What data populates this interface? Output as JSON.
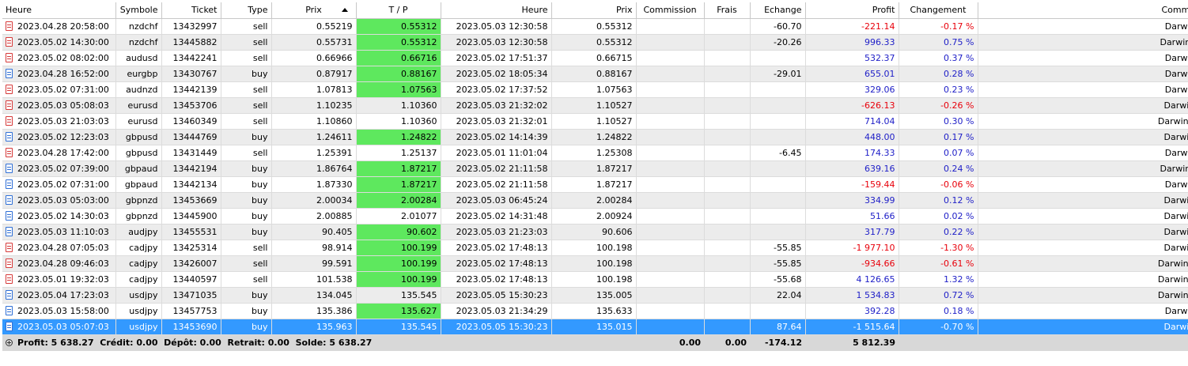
{
  "columns": {
    "open_time": "Heure",
    "symbol": "Symbole",
    "ticket": "Ticket",
    "type": "Type",
    "open_price": "Prix",
    "tp": "T / P",
    "close_time": "Heure",
    "close_price": "Prix",
    "commission": "Commission",
    "fees": "Frais",
    "swap": "Echange",
    "profit": "Profit",
    "change": "Changement",
    "comment": "Commentair"
  },
  "rows": [
    {
      "open_time": "2023.04.28 20:58:00",
      "symbol": "nzdchf",
      "ticket": "13432997",
      "type": "sell",
      "open_price": "0.55219",
      "tp": "0.55312",
      "tp_hit": true,
      "close_time": "2023.05.03 12:30:58",
      "close_price": "0.55312",
      "commission": "",
      "fees": "",
      "swap": "-60.70",
      "profit": "-221.14",
      "change": "-0.17 %",
      "comment": "Darwin Swing E"
    },
    {
      "open_time": "2023.05.02 14:30:00",
      "symbol": "nzdchf",
      "ticket": "13445882",
      "type": "sell",
      "open_price": "0.55731",
      "tp": "0.55312",
      "tp_hit": true,
      "close_time": "2023.05.03 12:30:58",
      "close_price": "0.55312",
      "commission": "",
      "fees": "",
      "swap": "-20.26",
      "profit": "996.33",
      "change": "0.75 %",
      "comment": "Darwin Swing EF"
    },
    {
      "open_time": "2023.05.02 08:02:00",
      "symbol": "audusd",
      "ticket": "13442241",
      "type": "sell",
      "open_price": "0.66966",
      "tp": "0.66716",
      "tp_hit": true,
      "close_time": "2023.05.02 17:51:37",
      "close_price": "0.66715",
      "commission": "",
      "fees": "",
      "swap": "",
      "profit": "532.37",
      "change": "0.37 %",
      "comment": "Darwin Swing E"
    },
    {
      "open_time": "2023.04.28 16:52:00",
      "symbol": "eurgbp",
      "ticket": "13430767",
      "type": "buy",
      "open_price": "0.87917",
      "tp": "0.88167",
      "tp_hit": true,
      "close_time": "2023.05.02 18:05:34",
      "close_price": "0.88167",
      "commission": "",
      "fees": "",
      "swap": "-29.01",
      "profit": "655.01",
      "change": "0.28 %",
      "comment": "Darwin Swing E"
    },
    {
      "open_time": "2023.05.02 07:31:00",
      "symbol": "audnzd",
      "ticket": "13442139",
      "type": "sell",
      "open_price": "1.07813",
      "tp": "1.07563",
      "tp_hit": true,
      "close_time": "2023.05.02 17:37:52",
      "close_price": "1.07563",
      "commission": "",
      "fees": "",
      "swap": "",
      "profit": "329.06",
      "change": "0.23 %",
      "comment": "Darwin Swing E"
    },
    {
      "open_time": "2023.05.03 05:08:03",
      "symbol": "eurusd",
      "ticket": "13453706",
      "type": "sell",
      "open_price": "1.10235",
      "tp": "1.10360",
      "tp_hit": false,
      "close_time": "2023.05.03 21:32:02",
      "close_price": "1.10527",
      "commission": "",
      "fees": "",
      "swap": "",
      "profit": "-626.13",
      "change": "-0.26 %",
      "comment": "Darwin Swing N"
    },
    {
      "open_time": "2023.05.03 21:03:03",
      "symbol": "eurusd",
      "ticket": "13460349",
      "type": "sell",
      "open_price": "1.10860",
      "tp": "1.10360",
      "tp_hit": false,
      "close_time": "2023.05.03 21:32:01",
      "close_price": "1.10527",
      "commission": "",
      "fees": "",
      "swap": "",
      "profit": "714.04",
      "change": "0.30 %",
      "comment": "Darwin Swing NR"
    },
    {
      "open_time": "2023.05.02 12:23:03",
      "symbol": "gbpusd",
      "ticket": "13444769",
      "type": "buy",
      "open_price": "1.24611",
      "tp": "1.24822",
      "tp_hit": true,
      "close_time": "2023.05.02 14:14:39",
      "close_price": "1.24822",
      "commission": "",
      "fees": "",
      "swap": "",
      "profit": "448.00",
      "change": "0.17 %",
      "comment": "Darwin Swing N"
    },
    {
      "open_time": "2023.04.28 17:42:00",
      "symbol": "gbpusd",
      "ticket": "13431449",
      "type": "sell",
      "open_price": "1.25391",
      "tp": "1.25137",
      "tp_hit": false,
      "close_time": "2023.05.01 11:01:04",
      "close_price": "1.25308",
      "commission": "",
      "fees": "",
      "swap": "-6.45",
      "profit": "174.33",
      "change": "0.07 %",
      "comment": "Darwin Swing E"
    },
    {
      "open_time": "2023.05.02 07:39:00",
      "symbol": "gbpaud",
      "ticket": "13442194",
      "type": "buy",
      "open_price": "1.86764",
      "tp": "1.87217",
      "tp_hit": true,
      "close_time": "2023.05.02 21:11:58",
      "close_price": "1.87217",
      "commission": "",
      "fees": "",
      "swap": "",
      "profit": "639.16",
      "change": "0.24 %",
      "comment": "Darwin Swing EF"
    },
    {
      "open_time": "2023.05.02 07:31:00",
      "symbol": "gbpaud",
      "ticket": "13442134",
      "type": "buy",
      "open_price": "1.87330",
      "tp": "1.87217",
      "tp_hit": true,
      "close_time": "2023.05.02 21:11:58",
      "close_price": "1.87217",
      "commission": "",
      "fees": "",
      "swap": "",
      "profit": "-159.44",
      "change": "-0.06 %",
      "comment": "Darwin Swing E"
    },
    {
      "open_time": "2023.05.03 05:03:00",
      "symbol": "gbpnzd",
      "ticket": "13453669",
      "type": "buy",
      "open_price": "2.00034",
      "tp": "2.00284",
      "tp_hit": true,
      "close_time": "2023.05.03 06:45:24",
      "close_price": "2.00284",
      "commission": "",
      "fees": "",
      "swap": "",
      "profit": "334.99",
      "change": "0.12 %",
      "comment": "Darwin Swing N"
    },
    {
      "open_time": "2023.05.02 14:30:03",
      "symbol": "gbpnzd",
      "ticket": "13445900",
      "type": "buy",
      "open_price": "2.00885",
      "tp": "2.01077",
      "tp_hit": false,
      "close_time": "2023.05.02 14:31:48",
      "close_price": "2.00924",
      "commission": "",
      "fees": "",
      "swap": "",
      "profit": "51.66",
      "change": "0.02 %",
      "comment": "Darwin Swing N"
    },
    {
      "open_time": "2023.05.03 11:10:03",
      "symbol": "audjpy",
      "ticket": "13455531",
      "type": "buy",
      "open_price": "90.405",
      "tp": "90.602",
      "tp_hit": true,
      "close_time": "2023.05.03 21:23:03",
      "close_price": "90.606",
      "commission": "",
      "fees": "",
      "swap": "",
      "profit": "317.79",
      "change": "0.22 %",
      "comment": "Darwin Swing N"
    },
    {
      "open_time": "2023.04.28 07:05:03",
      "symbol": "cadjpy",
      "ticket": "13425314",
      "type": "sell",
      "open_price": "98.914",
      "tp": "100.199",
      "tp_hit": true,
      "close_time": "2023.05.02 17:48:13",
      "close_price": "100.198",
      "commission": "",
      "fees": "",
      "swap": "-55.85",
      "profit": "-1 977.10",
      "change": "-1.30 %",
      "comment": "Darwin Swing N"
    },
    {
      "open_time": "2023.04.28 09:46:03",
      "symbol": "cadjpy",
      "ticket": "13426007",
      "type": "sell",
      "open_price": "99.591",
      "tp": "100.199",
      "tp_hit": true,
      "close_time": "2023.05.02 17:48:13",
      "close_price": "100.198",
      "commission": "",
      "fees": "",
      "swap": "-55.85",
      "profit": "-934.66",
      "change": "-0.61 %",
      "comment": "Darwin Swing NR"
    },
    {
      "open_time": "2023.05.01 19:32:03",
      "symbol": "cadjpy",
      "ticket": "13440597",
      "type": "sell",
      "open_price": "101.538",
      "tp": "100.199",
      "tp_hit": true,
      "close_time": "2023.05.02 17:48:13",
      "close_price": "100.198",
      "commission": "",
      "fees": "",
      "swap": "-55.68",
      "profit": "4 126.65",
      "change": "1.32 %",
      "comment": "Darwin Swing NR"
    },
    {
      "open_time": "2023.05.04 17:23:03",
      "symbol": "usdjpy",
      "ticket": "13471035",
      "type": "buy",
      "open_price": "134.045",
      "tp": "135.545",
      "tp_hit": false,
      "close_time": "2023.05.05 15:30:23",
      "close_price": "135.005",
      "commission": "",
      "fees": "",
      "swap": "22.04",
      "profit": "1 534.83",
      "change": "0.72 %",
      "comment": "Darwin Swing NR"
    },
    {
      "open_time": "2023.05.03 15:58:00",
      "symbol": "usdjpy",
      "ticket": "13457753",
      "type": "buy",
      "open_price": "135.386",
      "tp": "135.627",
      "tp_hit": true,
      "close_time": "2023.05.03 21:34:29",
      "close_price": "135.633",
      "commission": "",
      "fees": "",
      "swap": "",
      "profit": "392.28",
      "change": "0.18 %",
      "comment": "Darwin Swing E"
    },
    {
      "open_time": "2023.05.03 05:07:03",
      "symbol": "usdjpy",
      "ticket": "13453690",
      "type": "buy",
      "open_price": "135.963",
      "tp": "135.545",
      "tp_hit": false,
      "close_time": "2023.05.05 15:30:23",
      "close_price": "135.015",
      "commission": "",
      "fees": "",
      "swap": "87.64",
      "profit": "-1 515.64",
      "change": "-0.70 %",
      "comment": "Darwin Swing N",
      "selected": true
    }
  ],
  "summary": {
    "text": "Profit: 5 638.27  Crédit: 0.00  Dépôt: 0.00  Retrait: 0.00  Solde: 5 638.27",
    "commission_total": "0.00",
    "fees_total": "0.00",
    "swap_total": "-174.12",
    "profit_total": "5 812.39"
  },
  "colors": {
    "tp_highlight": "#5ee85e",
    "selected_row": "#3399ff",
    "negative": "#e8000b",
    "positive": "#2020c8",
    "sell_icon": "#d63a3a",
    "buy_icon": "#2f6fd6"
  },
  "icons": {
    "sell_row": "sell-document-icon",
    "buy_row": "buy-document-icon",
    "sort": "sort-ascending-icon",
    "summary": "expand-plus-icon"
  }
}
